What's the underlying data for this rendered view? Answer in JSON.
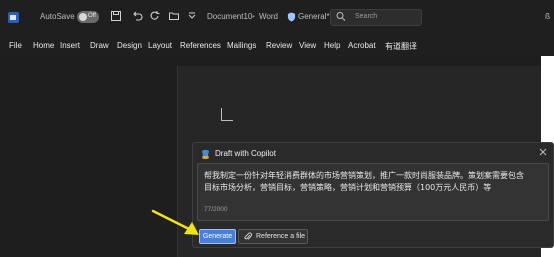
{
  "titlebar": {
    "autosave_label": "AutoSave",
    "toggle_state": "Off",
    "doc_title": "Document10",
    "app_name": "Word",
    "sensitivity_label": "General*",
    "search_placeholder": "Search"
  },
  "menu": [
    {
      "label": "File"
    },
    {
      "label": "Home"
    },
    {
      "label": "Insert"
    },
    {
      "label": "Draw"
    },
    {
      "label": "Design"
    },
    {
      "label": "Layout"
    },
    {
      "label": "References"
    },
    {
      "label": "Mailings"
    },
    {
      "label": "Review"
    },
    {
      "label": "View"
    },
    {
      "label": "Help"
    },
    {
      "label": "Acrobat"
    },
    {
      "label": "有道翻译"
    }
  ],
  "copilot": {
    "title": "Draft with Copilot",
    "prompt_line1": "帮我制定一份针对年轻消费群体的市场营销策划，推广一款时尚服装品牌。策划案需要包含",
    "prompt_line2": "目标市场分析，营销目标，营销策略，营销计划和营销预算（100万元人民币）等",
    "char_count": "77/2000",
    "generate_label": "Generate",
    "reference_label": "Reference a file"
  },
  "colors": {
    "accent": "#4a7fd6",
    "annotation_arrow": "#f2e21b"
  }
}
